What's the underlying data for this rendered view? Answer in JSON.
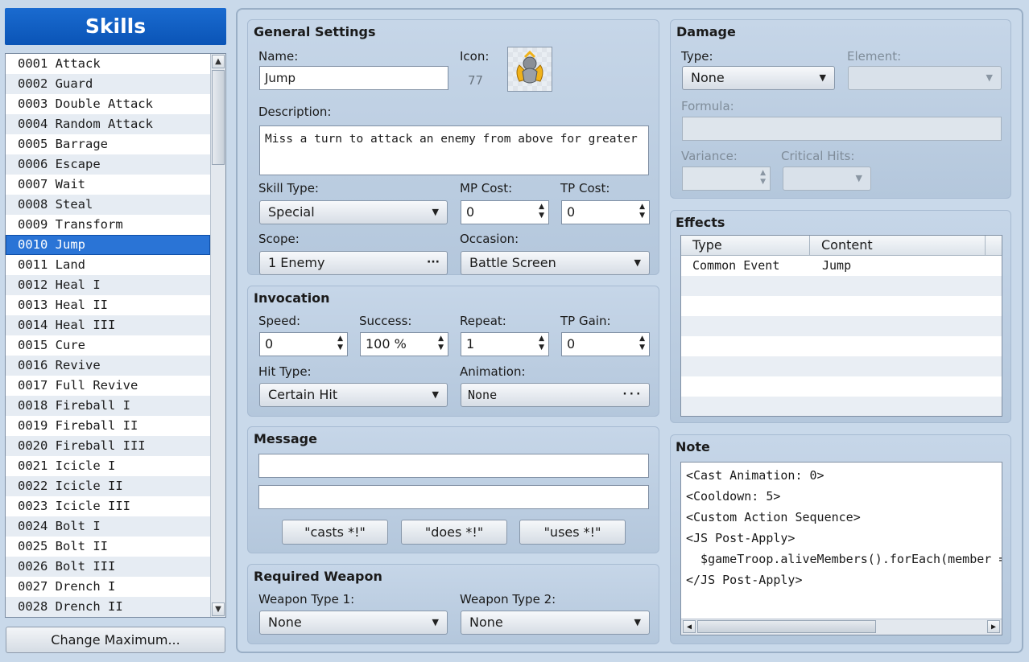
{
  "window": {
    "title": "Skills"
  },
  "skill_list": {
    "items": [
      "0001 Attack",
      "0002 Guard",
      "0003 Double Attack",
      "0004 Random Attack",
      "0005 Barrage",
      "0006 Escape",
      "0007 Wait",
      "0008 Steal",
      "0009 Transform",
      "0010 Jump",
      "0011 Land",
      "0012 Heal I",
      "0013 Heal II",
      "0014 Heal III",
      "0015 Cure",
      "0016 Revive",
      "0017 Full Revive",
      "0018 Fireball I",
      "0019 Fireball II",
      "0020 Fireball III",
      "0021 Icicle I",
      "0022 Icicle II",
      "0023 Icicle III",
      "0024 Bolt I",
      "0025 Bolt II",
      "0026 Bolt III",
      "0027 Drench I",
      "0028 Drench II"
    ],
    "selected_index": 9,
    "change_max_label": "Change Maximum..."
  },
  "general": {
    "title": "General Settings",
    "name_label": "Name:",
    "name_value": "Jump",
    "icon_label": "Icon:",
    "icon_index": "77",
    "desc_label": "Description:",
    "desc_value": "Miss a turn to attack an enemy from above for greater",
    "skill_type_label": "Skill Type:",
    "skill_type_value": "Special",
    "mp_cost_label": "MP Cost:",
    "mp_cost_value": "0",
    "tp_cost_label": "TP Cost:",
    "tp_cost_value": "0",
    "scope_label": "Scope:",
    "scope_value": "1 Enemy",
    "occasion_label": "Occasion:",
    "occasion_value": "Battle Screen"
  },
  "invocation": {
    "title": "Invocation",
    "speed_label": "Speed:",
    "speed_value": "0",
    "success_label": "Success:",
    "success_value": "100 %",
    "repeat_label": "Repeat:",
    "repeat_value": "1",
    "tp_gain_label": "TP Gain:",
    "tp_gain_value": "0",
    "hit_type_label": "Hit Type:",
    "hit_type_value": "Certain Hit",
    "animation_label": "Animation:",
    "animation_value": "None"
  },
  "message": {
    "title": "Message",
    "line1": "",
    "line2": "",
    "btn_casts": "\"casts *!\"",
    "btn_does": "\"does *!\"",
    "btn_uses": "\"uses *!\""
  },
  "required_weapon": {
    "title": "Required Weapon",
    "type1_label": "Weapon Type 1:",
    "type1_value": "None",
    "type2_label": "Weapon Type 2:",
    "type2_value": "None"
  },
  "damage": {
    "title": "Damage",
    "type_label": "Type:",
    "type_value": "None",
    "element_label": "Element:",
    "element_value": "",
    "formula_label": "Formula:",
    "formula_value": "",
    "variance_label": "Variance:",
    "variance_value": "",
    "critical_label": "Critical Hits:",
    "critical_value": ""
  },
  "effects": {
    "title": "Effects",
    "col_type": "Type",
    "col_content": "Content",
    "rows": [
      {
        "type": "Common Event",
        "content": "Jump"
      }
    ]
  },
  "note": {
    "title": "Note",
    "lines": [
      "<Cast Animation: 0>",
      "<Cooldown: 5>",
      "<Custom Action Sequence>",
      "<JS Post-Apply>",
      "  $gameTroop.aliveMembers().forEach(member =",
      "</JS Post-Apply>"
    ]
  },
  "icons": {
    "dropdown": "chevron-down-icon",
    "ellipsis": "ellipsis-icon",
    "spin": "spin-up-down-icon",
    "skill_icon": "leaping-figure-icon"
  },
  "colors": {
    "header_blue": "#0a54b6",
    "selection_blue": "#2a74d6"
  }
}
